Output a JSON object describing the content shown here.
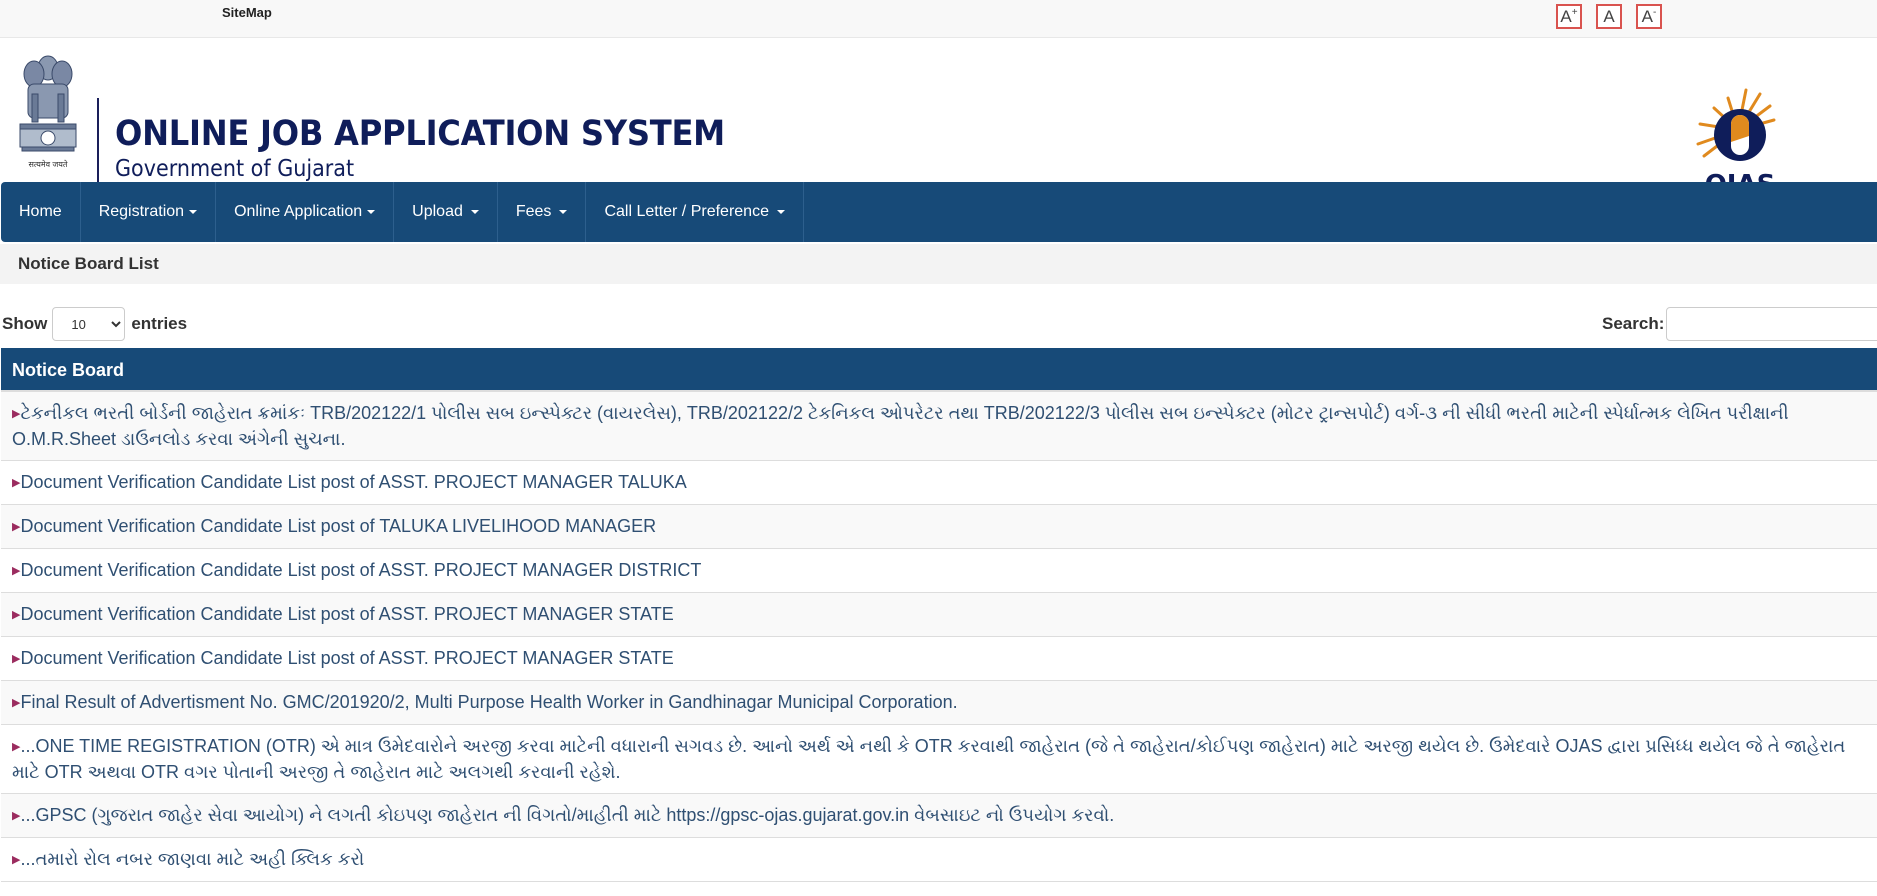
{
  "topbar": {
    "sitemap_label": "SiteMap",
    "font_increase": "A",
    "font_increase_sup": "+",
    "font_normal": "A",
    "font_decrease": "A",
    "font_decrease_sup": "-"
  },
  "header": {
    "title": "ONLINE JOB APPLICATION SYSTEM",
    "subtitle": "Government of Gujarat",
    "emblem_caption": "सत्यमेव जयते",
    "logo_text": "OJAS",
    "colors": {
      "brand_navy": "#0f1d5a",
      "brand_orange": "#e08a1e"
    }
  },
  "nav": {
    "items": [
      {
        "label": "Home",
        "dropdown": false
      },
      {
        "label": "Registration",
        "dropdown": true
      },
      {
        "label": "Online Application",
        "dropdown": true
      },
      {
        "label": "Upload",
        "dropdown": true
      },
      {
        "label": "Fees",
        "dropdown": true
      },
      {
        "label": "Call Letter / Preference",
        "dropdown": true
      }
    ],
    "color": "#174a78"
  },
  "panel": {
    "title": "Notice Board List"
  },
  "table_controls": {
    "show_label": "Show",
    "entries_value": "10",
    "entries_label": "entries",
    "search_label": "Search:",
    "search_value": ""
  },
  "table": {
    "header": "Notice Board",
    "rows": [
      "ટેકનીકલ ભરતી બોર્ડની જાહેરાત ક્રમાંકઃ TRB/202122/1 પોલીસ સબ ઇન્સ્પેક્ટર (વાયરલેસ), TRB/202122/2 ટેકનિકલ ઓપરેટર તથા TRB/202122/3 પોલીસ સબ ઇન્સ્પેક્ટર (મોટર ટ્રાન્સપોર્ટ) વર્ગ-૩ ની સીધી ભરતી માટેની સ્પેર્ધાત્મક લેખિત પરીક્ષાની O.M.R.Sheet ડાઉનલોડ કરવા અંગેની સુચના.",
      "Document Verification Candidate List post of ASST. PROJECT MANAGER TALUKA",
      "Document Verification Candidate List post of TALUKA LIVELIHOOD MANAGER",
      "Document Verification Candidate List post of ASST. PROJECT MANAGER DISTRICT",
      "Document Verification Candidate List post of ASST. PROJECT MANAGER STATE",
      "Document Verification Candidate List post of ASST. PROJECT MANAGER STATE",
      "Final Result of Advertisment No. GMC/201920/2, Multi Purpose Health Worker in Gandhinagar Municipal Corporation.",
      "...ONE TIME REGISTRATION (OTR) એ માત્ર ઉમેદવારોને અરજી કરવા માટેની વધારાની સગવડ છે. આનો અર્થ એ નથી કે OTR કરવાથી જાહેરાત (જે તે જાહેરાત/કોઈપણ જાહેરાત) માટે અરજી થયેલ છે. ઉમેદવારે OJAS દ્વારા પ્રસિધ્ધ થયેલ જે તે જાહેરાત માટે OTR અથવા OTR વગર પોતાની અરજી તે જાહેરાત માટે અલગથી કરવાની રહેશે.",
      "...GPSC (ગુજરાત જાહેર સેવા આયોગ) ને લગતી કોઇપણ જાહેરાત ની વિગતો/માહીતી માટે https://gpsc-ojas.gujarat.gov.in વેબસાઇટ નો ઉપયોગ કરવો.",
      "...તમારો રોલ નબર જાણવા માટે અહી ક્લિક કરો"
    ],
    "bullet": "▶",
    "link_color": "#2f4f72",
    "bullet_color": "#9b2c5f"
  }
}
